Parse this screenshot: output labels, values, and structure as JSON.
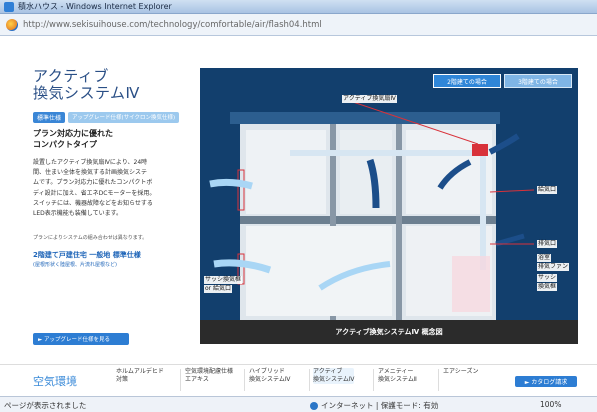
{
  "window": {
    "title": "積水ハウス - Windows Internet Explorer"
  },
  "address": {
    "url": "http://www.sekisuihouse.com/technology/comfortable/air/flash04.html"
  },
  "page": {
    "heading_line1": "アクティブ",
    "heading_line2": "換気システムⅣ",
    "badge_standard": "標準仕様",
    "badge_upgrade": "アップグレード仕様(サイクロン換気仕様)",
    "sub_heading_line1": "プラン対応力に優れた",
    "sub_heading_line2": "コンパクトタイプ",
    "description_lines": [
      "設置したアクティブ換気扇Ⅳにより、24時",
      "間、住まい全体を換気する計画換気システ",
      "ムです。プラン対応力に優れたコンパクトボ",
      "ディ設計に加え、省エネDCモーターを採用。",
      "スイッチには、機器故障などをお知らせする",
      "LED表示機能も装備しています。"
    ],
    "note": "プランによりシステムの組み合わせは異なります。",
    "spec_heading": "2階建て戸建住宅 一般地 標準仕様",
    "spec_sub": "(屋根形状く陸屋根、片流れ屋根など)",
    "upgrade_button": "► アップグレード仕様を見る"
  },
  "diagram": {
    "tab_2f": "2階建ての場合",
    "tab_3f": "3階建ての場合",
    "caption": "アクティブ換気システムⅣ 概念図",
    "callouts": {
      "fan": "アクティブ換気扇Ⅳ",
      "supply": "給気口",
      "sash_left_1": "サッシ換気框",
      "sash_left_2": "or 給気口",
      "exhaust": "排気口",
      "bath_1": "浴室",
      "bath_2": "排気ファン",
      "sash_right_1": "サッシ",
      "sash_right_2": "換気框"
    },
    "colors": {
      "air_light": "#a9d6f5",
      "air_dark": "#1c4e8a",
      "duct": "#d7e6f2",
      "fan": "#d8323a"
    }
  },
  "bottom_nav": {
    "section_title": "空気環境",
    "items": [
      {
        "line1": "ホルムアルデヒド",
        "line2": "対策"
      },
      {
        "line1": "空気環境配慮仕様",
        "line2": "エアキス"
      },
      {
        "line1": "ハイブリッド",
        "line2": "換気システムⅣ"
      },
      {
        "line1": "アクティブ",
        "line2": "換気システムⅣ"
      },
      {
        "line1": "アメニティー",
        "line2": "換気システムⅡ"
      },
      {
        "line1": "エアシーズン",
        "line2": ""
      }
    ],
    "catalog_button": "► カタログ請求"
  },
  "statusbar": {
    "left": "ページが表示されました",
    "zone": "インターネット | 保護モード: 有効",
    "zoom": "100%"
  }
}
